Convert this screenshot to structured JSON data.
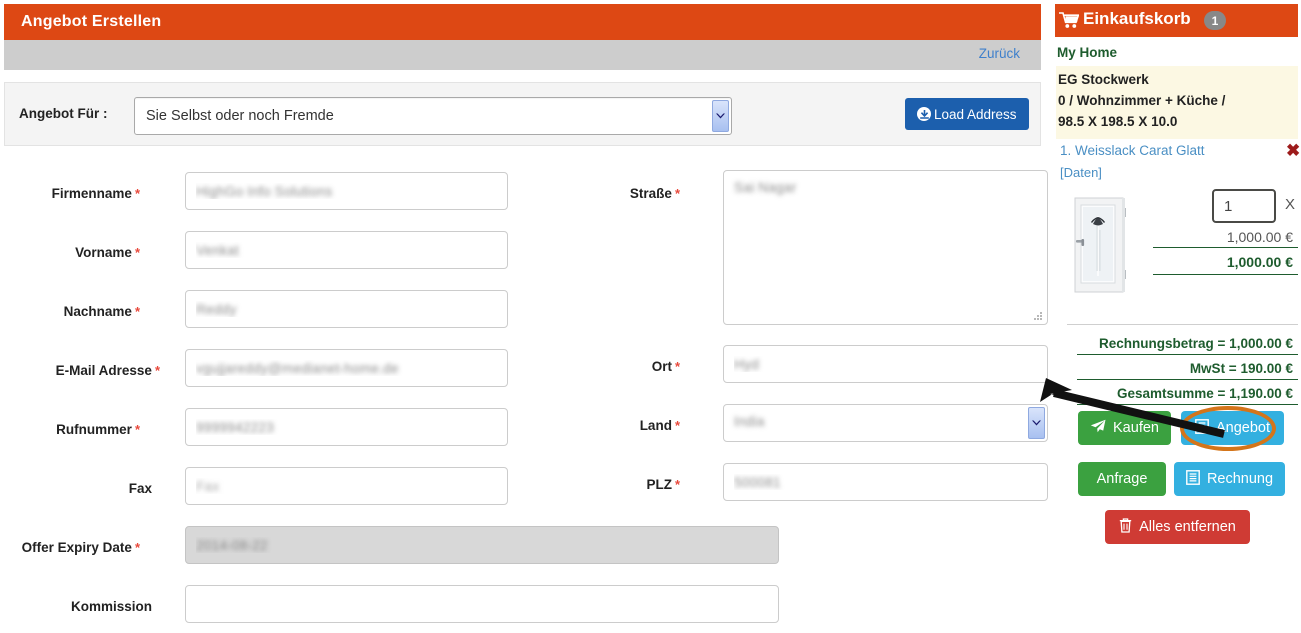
{
  "page": {
    "header_title": "Angebot Erstellen",
    "back_link": "Zurück"
  },
  "colors": {
    "brand_orange": "#dd4814",
    "subbar_gray": "#cdcdcd",
    "link_blue": "#3f80cc",
    "button_blue": "#1c5fad",
    "cart_green": "#3ba140",
    "cart_lightblue": "#33b0e0",
    "cart_red": "#cf3b34",
    "total_green": "#1e5c2e",
    "floor_box_cream": "#fcf8e3",
    "annotation_orange": "#d4751a",
    "required_red": "#e8493c"
  },
  "offer_for": {
    "label": "Angebot Für :",
    "selected": "Sie Selbst oder noch Fremde",
    "load_address_button": "Load Address"
  },
  "form": {
    "left_fields": [
      {
        "label": "Firmenname",
        "required": true,
        "value": "HighGo Info Solutions",
        "placeholder": ""
      },
      {
        "label": "Vorname",
        "required": true,
        "value": "Venkat",
        "placeholder": ""
      },
      {
        "label": "Nachname",
        "required": true,
        "value": "Reddy",
        "placeholder": ""
      },
      {
        "label": "E-Mail Adresse",
        "required": true,
        "value": "vgujjareddy@medianet-home.de",
        "placeholder": ""
      },
      {
        "label": "Rufnummer",
        "required": true,
        "value": "9999942223",
        "placeholder": ""
      },
      {
        "label": "Fax",
        "required": false,
        "value": "",
        "placeholder": "Fax"
      },
      {
        "label": "Offer Expiry Date",
        "required": true,
        "value": "2014-08-22",
        "placeholder": "",
        "readonly": true
      },
      {
        "label": "Kommission",
        "required": false,
        "value": "",
        "placeholder": ""
      }
    ],
    "right_fields": [
      {
        "label": "Straße",
        "required": true,
        "type": "textarea",
        "value": "Sai Nagar",
        "placeholder": ""
      },
      {
        "label": "Ort",
        "required": true,
        "type": "text",
        "value": "Hyd",
        "placeholder": ""
      },
      {
        "label": "Land",
        "required": true,
        "type": "select",
        "value": "India",
        "placeholder": ""
      },
      {
        "label": "PLZ",
        "required": true,
        "type": "text",
        "value": "500081",
        "placeholder": ""
      }
    ]
  },
  "cart": {
    "title": "Einkaufskorb",
    "count_badge": "1",
    "home_name": "My Home",
    "floor_line1": "EG Stockwerk",
    "floor_line2": "0 / Wohnzimmer + Küche /",
    "floor_line3": "98.5 X 198.5 X 10.0",
    "item_name": "1. Weisslack Carat Glatt",
    "item_data_link": "[Daten]",
    "remove_item_icon": "✖",
    "quantity": "1",
    "multiply_symbol": "X",
    "unit_price": "1,000.00 €",
    "line_total": "1,000.00 €",
    "totals": [
      {
        "label": "Rechnungsbetrag = 1,000.00 €"
      },
      {
        "label": "MwSt = 190.00 €"
      },
      {
        "label": "Gesamtsumme = 1,190.00 €"
      }
    ],
    "buttons": {
      "kaufen": "Kaufen",
      "angebot": "Angebot",
      "anfrage": "Anfrage",
      "rechnung": "Rechnung",
      "alles_entfernen": "Alles entfernen"
    }
  }
}
